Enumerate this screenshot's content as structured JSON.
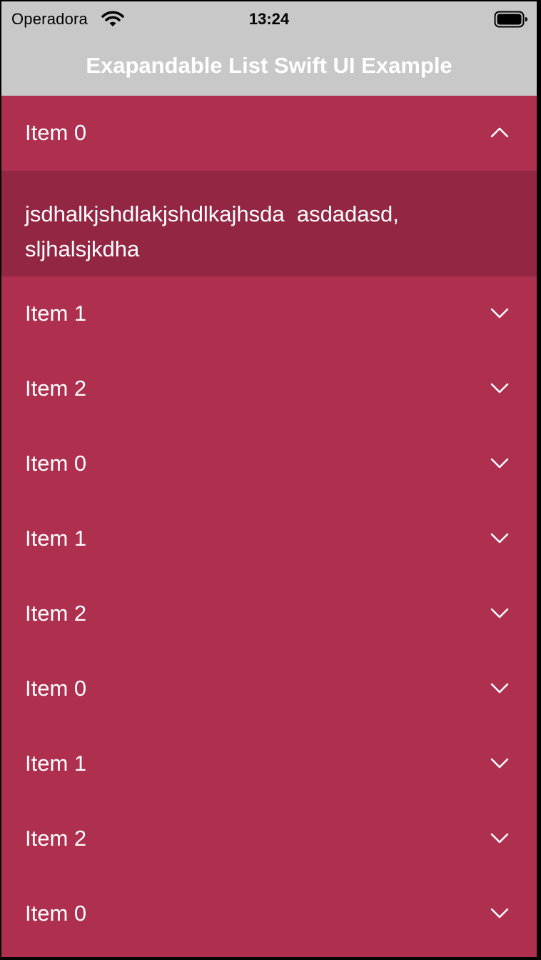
{
  "status_bar": {
    "carrier": "Operadora",
    "time": "13:24",
    "wifi_icon": "wifi-icon",
    "battery_icon": "battery-icon"
  },
  "nav": {
    "title": "Exapandable List Swift UI Example"
  },
  "colors": {
    "row_background": "#ae2f4e",
    "expanded_background": "#932643",
    "bar_background": "#c8c8c8",
    "text": "#ffffff"
  },
  "list": {
    "items": [
      {
        "label": "Item 0",
        "expanded": true,
        "icon": "chevron-up-icon"
      },
      {
        "label": "Item 1",
        "expanded": false,
        "icon": "chevron-down-icon"
      },
      {
        "label": "Item 2",
        "expanded": false,
        "icon": "chevron-down-icon"
      },
      {
        "label": "Item 0",
        "expanded": false,
        "icon": "chevron-down-icon"
      },
      {
        "label": "Item 1",
        "expanded": false,
        "icon": "chevron-down-icon"
      },
      {
        "label": "Item 2",
        "expanded": false,
        "icon": "chevron-down-icon"
      },
      {
        "label": "Item 0",
        "expanded": false,
        "icon": "chevron-down-icon"
      },
      {
        "label": "Item 1",
        "expanded": false,
        "icon": "chevron-down-icon"
      },
      {
        "label": "Item 2",
        "expanded": false,
        "icon": "chevron-down-icon"
      },
      {
        "label": "Item 0",
        "expanded": false,
        "icon": "chevron-down-icon"
      }
    ],
    "expanded_text": "jsdhalkjshdlakjshdlkajhsda  asdadasd, sljhalsjkdha"
  }
}
